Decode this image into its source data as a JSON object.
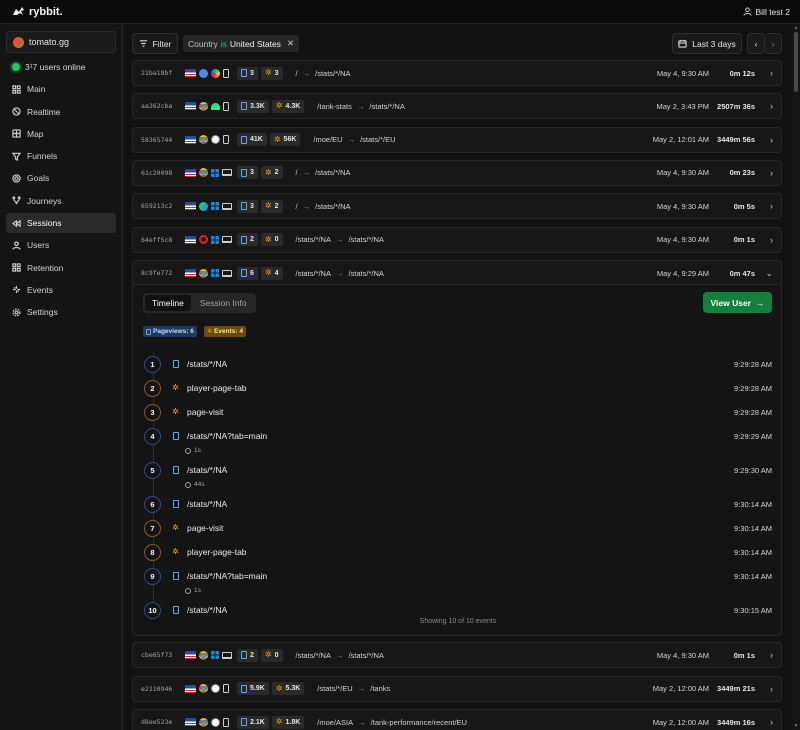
{
  "app": {
    "brand": "rybbit.",
    "user": "Bill test 2"
  },
  "sidebar": {
    "site": "tomato.gg",
    "online": "3¹7 users online",
    "items": [
      {
        "label": "Main",
        "icon": "grid-icon"
      },
      {
        "label": "Realtime",
        "icon": "pulse-icon"
      },
      {
        "label": "Map",
        "icon": "map-icon"
      },
      {
        "label": "Funnels",
        "icon": "funnel-icon"
      },
      {
        "label": "Goals",
        "icon": "target-icon"
      },
      {
        "label": "Journeys",
        "icon": "branch-icon"
      },
      {
        "label": "Sessions",
        "icon": "rewind-icon",
        "active": true
      },
      {
        "label": "Users",
        "icon": "user-icon"
      },
      {
        "label": "Retention",
        "icon": "grid-icon"
      },
      {
        "label": "Events",
        "icon": "sparkle-icon"
      },
      {
        "label": "Settings",
        "icon": "gear-icon"
      }
    ]
  },
  "toolbar": {
    "filter_label": "Filter",
    "chip": {
      "field": "Country",
      "op": "is",
      "value": "United States"
    },
    "range_label": "Last 3 days"
  },
  "sessions": [
    {
      "id": "21ba18bf",
      "browser": "br-brave",
      "os": "os-apple",
      "device": "dev-phone",
      "pageviews": "3",
      "events": "3",
      "entry": "/",
      "exit": "/stats/*/NA",
      "time": "May 4, 9:30 AM",
      "duration": "0m 12s"
    },
    {
      "id": "aa262cba",
      "browser": "br-chrome",
      "os": "os-android",
      "device": "dev-phone",
      "pageviews": "3.3K",
      "events": "4.3K",
      "entry": "/tank-stats",
      "exit": "/stats/*/NA",
      "time": "May 2, 3:43 PM",
      "duration": "2507m 36s"
    },
    {
      "id": "58365744",
      "browser": "br-chrome",
      "os": "br-safari",
      "device": "dev-phone",
      "pageviews": "41K",
      "events": "56K",
      "entry": "/moe/EU",
      "exit": "/stats/*/EU",
      "time": "May 2, 12:01 AM",
      "duration": "3449m 56s"
    },
    {
      "id": "61c20098",
      "browser": "br-chrome",
      "os": "os-win",
      "device": "dev-laptop",
      "pageviews": "3",
      "events": "2",
      "entry": "/",
      "exit": "/stats/*/NA",
      "time": "May 4, 9:30 AM",
      "duration": "0m 23s"
    },
    {
      "id": "659213c2",
      "browser": "br-edge",
      "os": "os-win",
      "device": "dev-laptop",
      "pageviews": "3",
      "events": "2",
      "entry": "/",
      "exit": "/stats/*/NA",
      "time": "May 4, 9:30 AM",
      "duration": "0m 5s"
    },
    {
      "id": "64eff5c8",
      "browser": "br-opera",
      "os": "os-win",
      "device": "dev-laptop",
      "pageviews": "2",
      "events": "0",
      "entry": "/stats/*/NA",
      "exit": "/stats/*/NA",
      "time": "May 4, 9:30 AM",
      "duration": "0m 1s"
    },
    {
      "id": "8c9fe772",
      "browser": "br-chrome",
      "os": "os-win",
      "device": "dev-laptop",
      "pageviews": "6",
      "events": "4",
      "entry": "/stats/*/NA",
      "exit": "/stats/*/NA",
      "time": "May 4, 9:29 AM",
      "duration": "0m 47s"
    }
  ],
  "sessions_after": [
    {
      "id": "cbe65f73",
      "browser": "br-chrome",
      "os": "os-win",
      "device": "dev-laptop",
      "pageviews": "2",
      "events": "0",
      "entry": "/stats/*/NA",
      "exit": "/stats/*/NA",
      "time": "May 4, 9:30 AM",
      "duration": "0m 1s"
    },
    {
      "id": "e2110946",
      "browser": "br-chrome",
      "os": "br-safari",
      "device": "dev-phone",
      "pageviews": "5.9K",
      "events": "5.3K",
      "entry": "/stats/*/EU",
      "exit": "/tanks",
      "time": "May 2, 12:00 AM",
      "duration": "3449m 21s"
    },
    {
      "id": "d8ee523e",
      "browser": "br-chrome",
      "os": "br-safari",
      "device": "dev-phone",
      "pageviews": "2.1K",
      "events": "1.8K",
      "entry": "/moe/ASIA",
      "exit": "/tank-performance/recent/EU",
      "time": "May 2, 12:00 AM",
      "duration": "3449m 16s"
    }
  ],
  "detail": {
    "tabs": [
      "Timeline",
      "Session Info"
    ],
    "view_user": "View User",
    "pageviews_tag": "Pageviews: 6",
    "events_tag": "Events: 4",
    "events": [
      {
        "n": "1",
        "kind": "pv",
        "label": "/stats/*/NA",
        "time": "9:29:28 AM",
        "sub": ""
      },
      {
        "n": "2",
        "kind": "ev",
        "label": "player-page-tab",
        "time": "9:29:28 AM",
        "sub": ""
      },
      {
        "n": "3",
        "kind": "ev",
        "label": "page-visit",
        "time": "9:29:28 AM",
        "sub": ""
      },
      {
        "n": "4",
        "kind": "pv",
        "label": "/stats/*/NA?tab=main",
        "time": "9:29:29 AM",
        "sub": "1s"
      },
      {
        "n": "5",
        "kind": "pv",
        "label": "/stats/*/NA",
        "time": "9:29:30 AM",
        "sub": "44s"
      },
      {
        "n": "6",
        "kind": "pv",
        "label": "/stats/*/NA",
        "time": "9:30:14 AM",
        "sub": ""
      },
      {
        "n": "7",
        "kind": "ev",
        "label": "page-visit",
        "time": "9:30:14 AM",
        "sub": ""
      },
      {
        "n": "8",
        "kind": "ev",
        "label": "player-page-tab",
        "time": "9:30:14 AM",
        "sub": ""
      },
      {
        "n": "9",
        "kind": "pv",
        "label": "/stats/*/NA?tab=main",
        "time": "9:30:14 AM",
        "sub": "1s"
      },
      {
        "n": "10",
        "kind": "pv",
        "label": "/stats/*/NA",
        "time": "9:30:15 AM",
        "sub": ""
      }
    ],
    "footer": "Showing 10 of 10 events"
  }
}
